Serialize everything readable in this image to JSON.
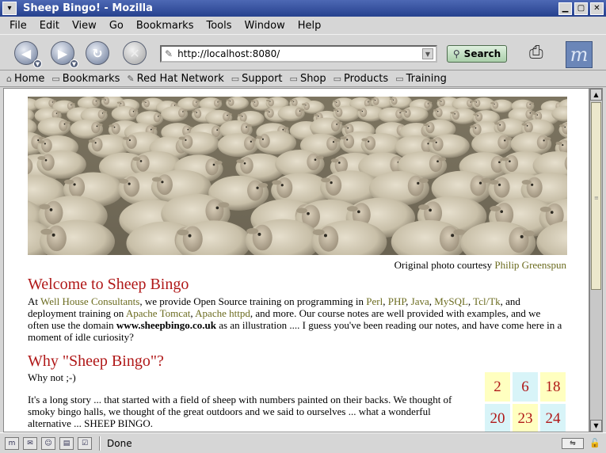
{
  "window": {
    "title": "Sheep Bingo! - Mozilla"
  },
  "menubar": {
    "items": [
      "File",
      "Edit",
      "View",
      "Go",
      "Bookmarks",
      "Tools",
      "Window",
      "Help"
    ]
  },
  "navigation": {
    "url": "http://localhost:8080/",
    "search_label": "Search",
    "icons": [
      "back-icon",
      "forward-icon",
      "reload-icon",
      "stop-icon",
      "search-icon",
      "mozilla-icon"
    ]
  },
  "personal_toolbar": {
    "items": [
      "Home",
      "Bookmarks",
      "Red Hat Network",
      "Support",
      "Shop",
      "Products",
      "Training"
    ]
  },
  "page": {
    "photo_credit_prefix": "Original photo courtesy",
    "photo_credit_link": "Philip Greenspun",
    "welcome_heading": "Welcome to Sheep Bingo",
    "intro": {
      "p1": "At",
      "well_house": "Well House Consultants",
      "p2": ", we provide Open Source training on programming in",
      "perl": "Perl",
      "php": "PHP",
      "java": "Java",
      "mysql": "MySQL",
      "tcltk": "Tcl/Tk",
      "p3": ", and deployment training on",
      "tomcat": "Apache Tomcat",
      "httpd": "Apache httpd",
      "p4": ", and more. Our course notes are well provided with examples, and we often use the domain",
      "domain": "www.sheepbingo.co.uk",
      "p5": "as an illustration .... I guess you've been reading our notes, and have come here in a moment of idle curiosity?"
    },
    "why_heading": "Why \"Sheep Bingo\"?",
    "why_not": "Why not ;-)",
    "story": "It's a long story ... that started with a field of sheep with numbers painted on their backs. We thought of smoky bingo halls, we thought of the great outdoors and we said to ourselves ... what a wonderful alternative ... SHEEP BINGO.",
    "bingo_numbers": [
      "2",
      "6",
      "18",
      "20",
      "23",
      "24"
    ],
    "colors": {
      "heading": "#b01818",
      "link": "#6b6b1f",
      "bingo_yellow": "#ffffc0",
      "bingo_blue": "#d8f4f8"
    }
  },
  "statusbar": {
    "text": "Done"
  }
}
